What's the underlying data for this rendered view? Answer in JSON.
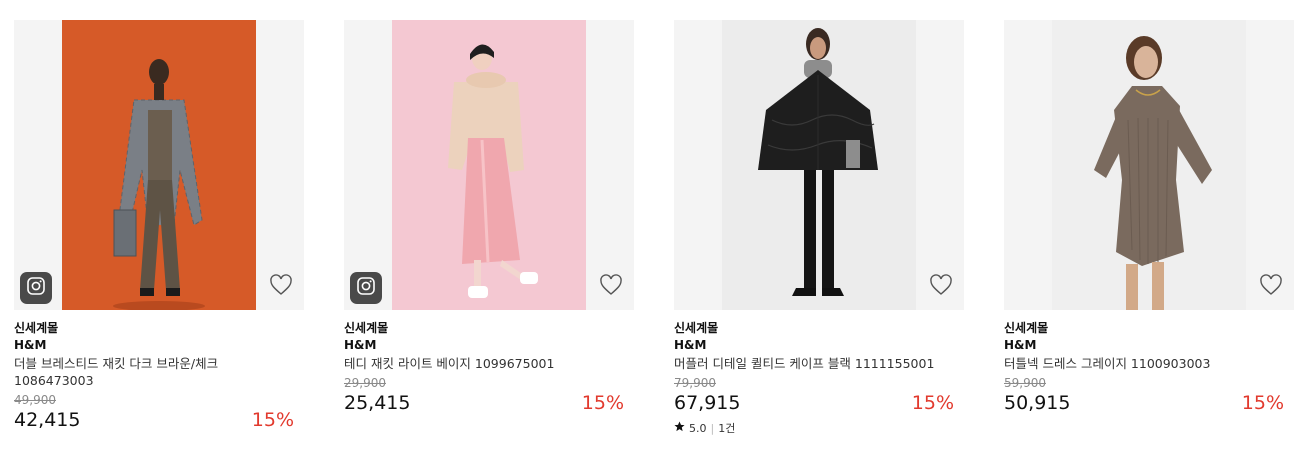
{
  "products": [
    {
      "seller": "신세계몰",
      "brand": "H&M",
      "name": "더블 브레스티드 재킷 다크 브라운/체크 1086473003",
      "original_price": "49,900",
      "price": "42,415",
      "discount": "15%",
      "has_instagram_badge": true,
      "photo_background": "#d65a28"
    },
    {
      "seller": "신세계몰",
      "brand": "H&M",
      "name": "테디 재킷 라이트 베이지 1099675001",
      "original_price": "29,900",
      "price": "25,415",
      "discount": "15%",
      "has_instagram_badge": true,
      "photo_background": "#f4c8d2"
    },
    {
      "seller": "신세계몰",
      "brand": "H&M",
      "name": "머플러 디테일 퀼티드 케이프 블랙 1111155001",
      "original_price": "79,900",
      "price": "67,915",
      "discount": "15%",
      "has_instagram_badge": false,
      "rating": "5.0",
      "review_count": "1건",
      "photo_background": "#ececec"
    },
    {
      "seller": "신세계몰",
      "brand": "H&M",
      "name": "터틀넥 드레스 그레이지 1100903003",
      "original_price": "59,900",
      "price": "50,915",
      "discount": "15%",
      "has_instagram_badge": false,
      "photo_background": "#efefef"
    }
  ],
  "icons": {
    "instagram": "instagram-icon",
    "wishlist": "heart-outline-icon",
    "star": "star-icon"
  },
  "colors": {
    "discount": "#e23a2e",
    "original_price": "#8a8a8a",
    "badge_bg": "#4a4a4a"
  }
}
